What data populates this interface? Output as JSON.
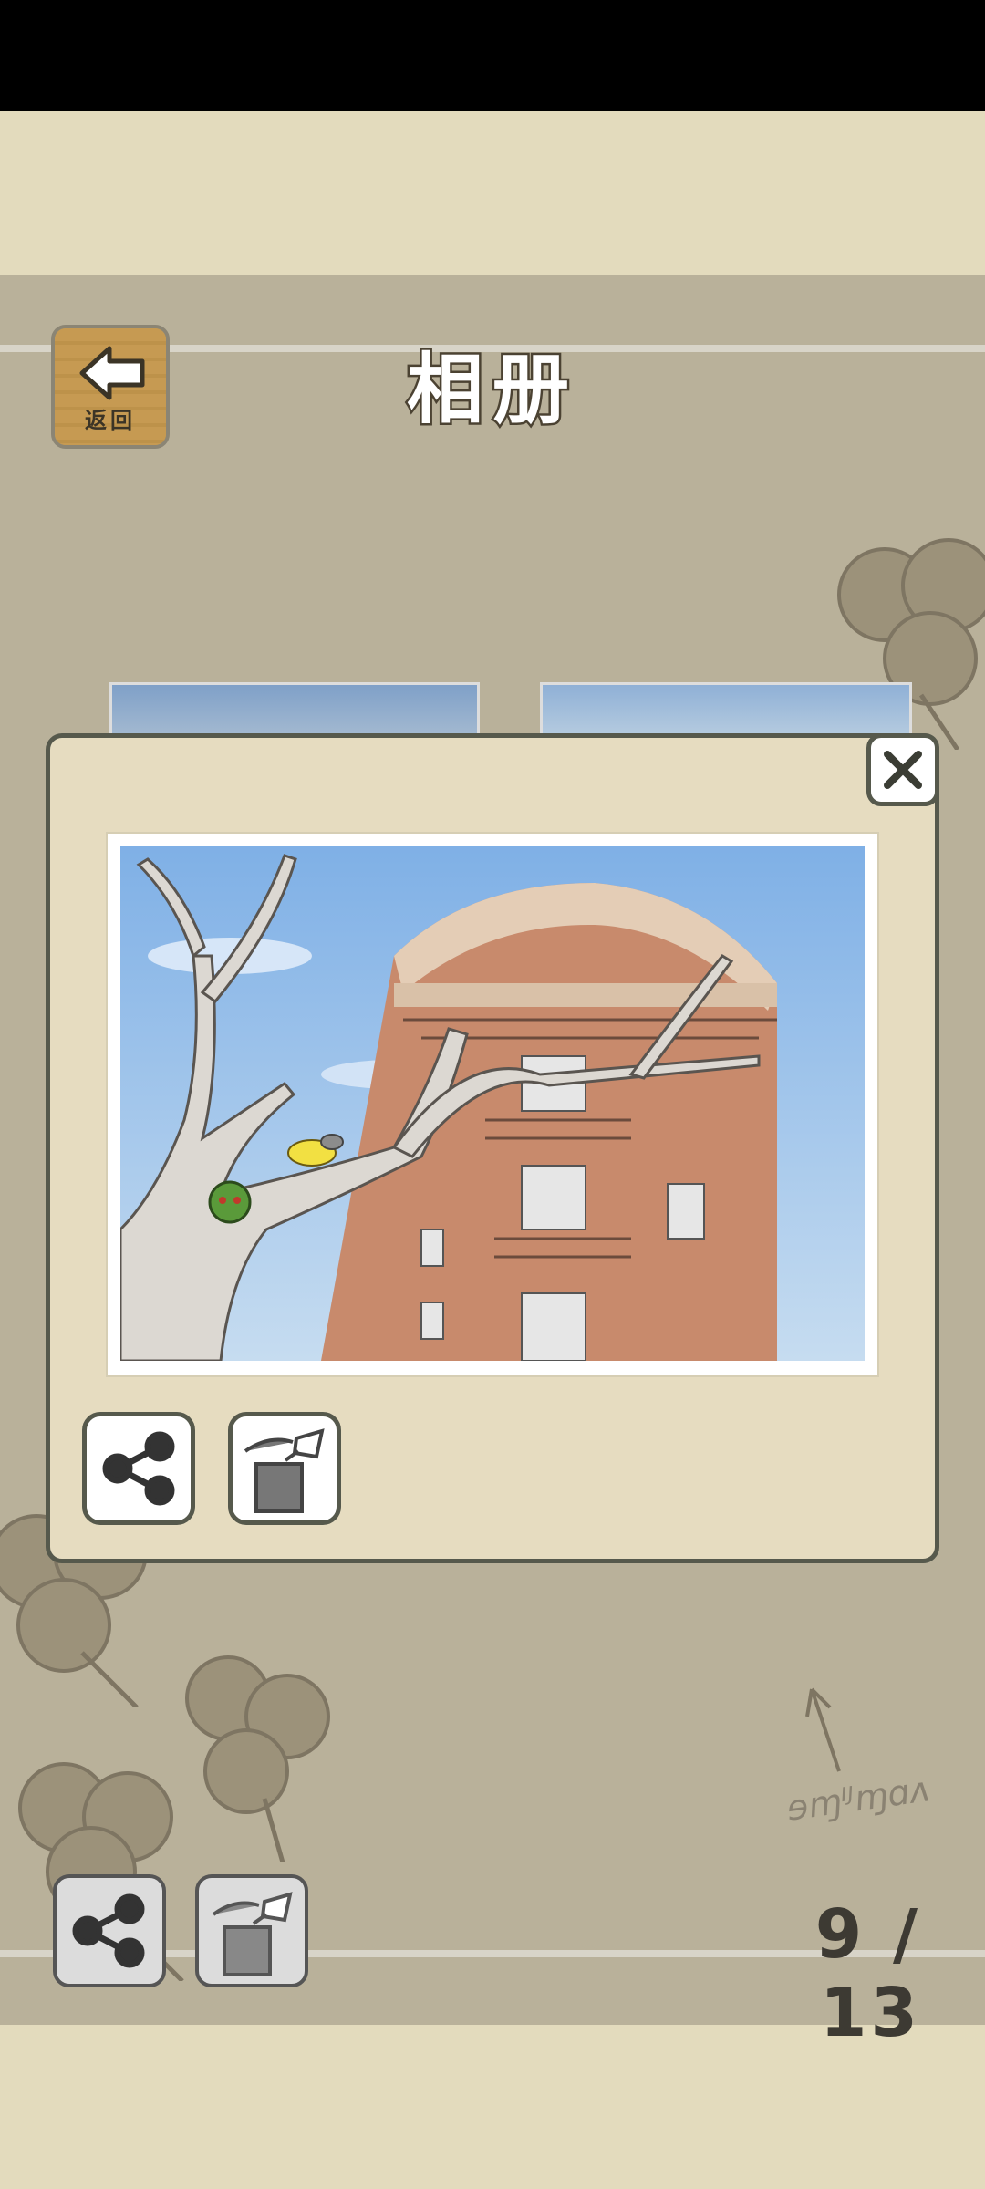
{
  "header": {
    "back_label": "返回",
    "title": "相册"
  },
  "footer": {
    "page_current": "9",
    "page_separator": "/",
    "page_total": "13"
  },
  "photo_dialog": {
    "image": "photo of tree branches in front of a round brick building with balconies, with a green frog and yellow bug in the tree"
  },
  "icons": {
    "back": "arrow-left-icon",
    "close": "close-icon",
    "share": "share-icon",
    "delete": "trash-icon"
  },
  "colors": {
    "album_bg": "#b9b19a",
    "band_bg": "#e3dbbd",
    "dialog_bg": "#e6dcc0",
    "dialog_border": "#56594c"
  }
}
